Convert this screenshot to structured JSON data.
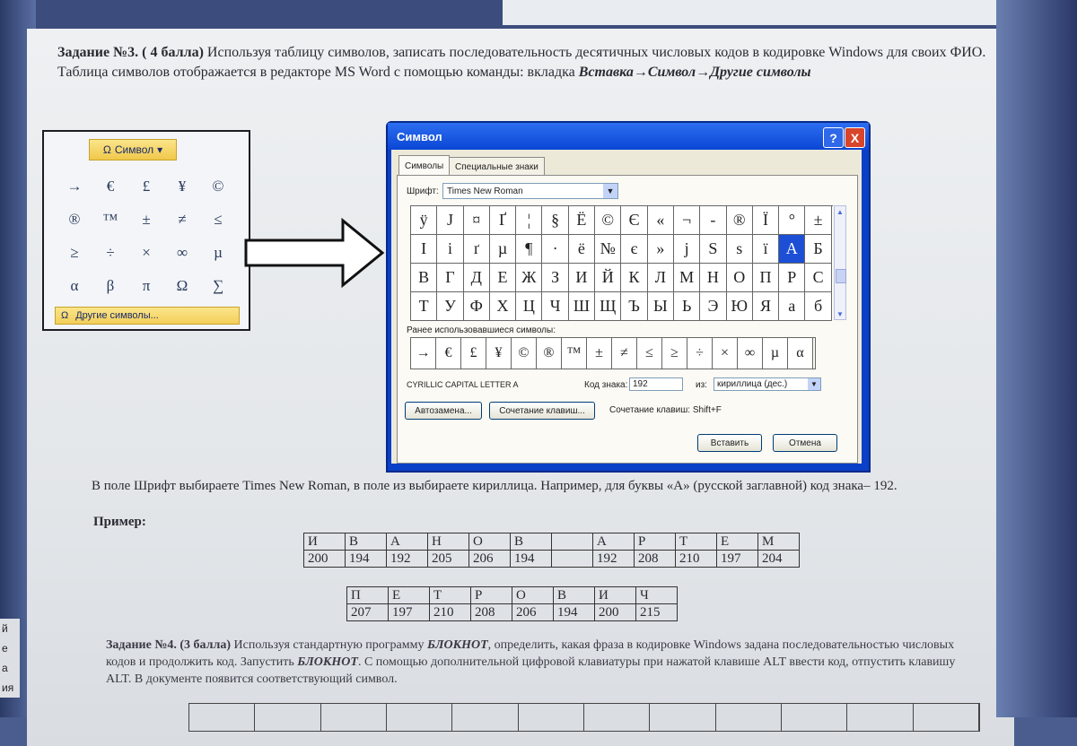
{
  "task3": {
    "heading": "Задание №3.",
    "points": "( 4 балла)",
    "text": "Используя таблицу символов, записать последовательность десятичных числовых кодов в кодировке Windows для своих ФИО. Таблица символов отображается в редакторе MS Word с помощью команды: вкладка",
    "path": "Вставка→Символ→Другие символы"
  },
  "ribbon": {
    "button_label": "Символ",
    "symbols": [
      "→",
      "€",
      "£",
      "¥",
      "©",
      "®",
      "™",
      "±",
      "≠",
      "≤",
      "≥",
      "÷",
      "×",
      "∞",
      "µ",
      "α",
      "β",
      "π",
      "Ω",
      "∑"
    ],
    "other_label": "Другие символы..."
  },
  "dialog": {
    "title": "Символ",
    "help": "?",
    "close": "X",
    "tabs": [
      "Символы",
      "Специальные знаки"
    ],
    "font_label": "Шрифт:",
    "font_value": "Times New Roman",
    "grid": [
      "ÿ",
      "Ј",
      "¤",
      "Ґ",
      "¦",
      "§",
      "Ё",
      "©",
      "Є",
      "«",
      "¬",
      "-",
      "®",
      "Ї",
      "°",
      "±",
      "І",
      "і",
      "ґ",
      "µ",
      "¶",
      "·",
      "ё",
      "№",
      "є",
      "»",
      "ј",
      "Ѕ",
      "ѕ",
      "ї",
      "А",
      "Б",
      "В",
      "Г",
      "Д",
      "Е",
      "Ж",
      "З",
      "И",
      "Й",
      "К",
      "Л",
      "М",
      "Н",
      "О",
      "П",
      "Р",
      "С",
      "Т",
      "У",
      "Ф",
      "Х",
      "Ц",
      "Ч",
      "Ш",
      "Щ",
      "Ъ",
      "Ы",
      "Ь",
      "Э",
      "Ю",
      "Я",
      "а",
      "б"
    ],
    "selected_index": 30,
    "recent_label": "Ранее использовавшиеся символы:",
    "recent": [
      "→",
      "€",
      "£",
      "¥",
      "©",
      "®",
      "™",
      "±",
      "≠",
      "≤",
      "≥",
      "÷",
      "×",
      "∞",
      "µ",
      "α"
    ],
    "char_name": "CYRILLIC CAPITAL LETTER A",
    "code_label": "Код знака:",
    "code_value": "192",
    "from_label": "из:",
    "from_value": "кириллица (дес.)",
    "autocorrect": "Автозамена...",
    "shortcut_btn": "Сочетание клавиш...",
    "shortcut_text": "Сочетание клавиш: Shift+F",
    "insert": "Вставить",
    "cancel": "Отмена"
  },
  "para": "В поле Шрифт выбираете Times New Roman, в поле из выбираете кириллица. Например, для буквы «А» (русской заглавной) код знака– 192.",
  "example_label": "Пример:",
  "table1": {
    "letters": [
      "И",
      "В",
      "А",
      "Н",
      "О",
      "В",
      "",
      "А",
      "Р",
      "Т",
      "Е",
      "М"
    ],
    "codes": [
      "200",
      "194",
      "192",
      "205",
      "206",
      "194",
      "",
      "192",
      "208",
      "210",
      "197",
      "204"
    ]
  },
  "table2": {
    "letters": [
      "П",
      "Е",
      "Т",
      "Р",
      "О",
      "В",
      "И",
      "Ч"
    ],
    "codes": [
      "207",
      "197",
      "210",
      "208",
      "206",
      "194",
      "200",
      "215"
    ]
  },
  "task4": {
    "heading": "Задание №4.",
    "points": "(3 балла)",
    "text1": "Используя стандартную программу",
    "app": "БЛОКНОТ",
    "text2": ", определить, какая фраза в кодировке Windows задана последовательностью числовых кодов и продолжить код. Запустить",
    "text3": ". С помощью дополнительной цифровой клавиатуры при нажатой клавише ALT ввести код, отпустить клавишу ALT. В документе появится соответствующий символ."
  },
  "edge_text": [
    "й",
    "е",
    "а",
    "ия"
  ]
}
